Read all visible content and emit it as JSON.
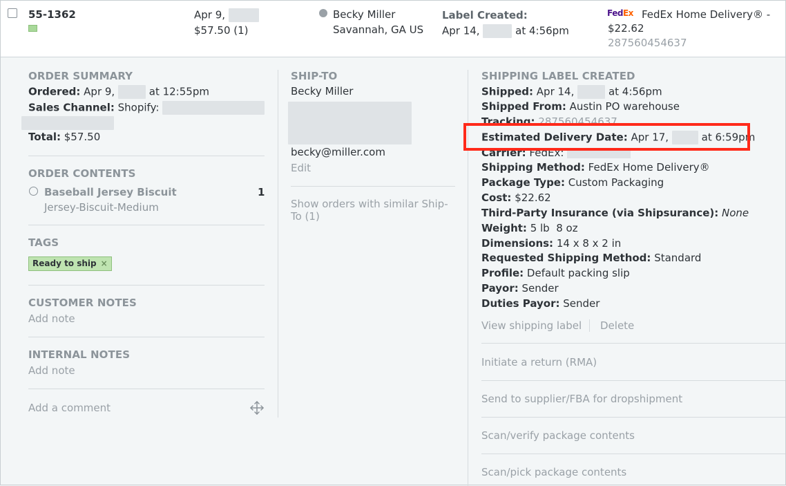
{
  "order": {
    "number": "55-1362",
    "date_prefix": "Apr 9,",
    "amount": "$57.50 (1)",
    "customer_name": "Becky Miller",
    "customer_location": "Savannah, GA US",
    "status_label": "Label Created:",
    "status_date_prefix": "Apr 14,",
    "status_time": "at 4:56pm",
    "carrier_logo_fed": "Fed",
    "carrier_logo_ex": "Ex",
    "carrier_service": "FedEx Home Delivery® -",
    "carrier_cost": "$22.62",
    "tracking_number": "287560454637"
  },
  "summary": {
    "title": "ORDER SUMMARY",
    "ordered_label": "Ordered:",
    "ordered_date": "Apr 9,",
    "ordered_time": "at 12:55pm",
    "sales_channel_label": "Sales Channel:",
    "sales_channel_value": "Shopify:",
    "total_label": "Total:",
    "total_value": "$57.50"
  },
  "contents": {
    "title": "ORDER CONTENTS",
    "item_name": "Baseball Jersey Biscuit",
    "item_sku": "Jersey-Biscuit-Medium",
    "item_qty": "1"
  },
  "tags": {
    "title": "TAGS",
    "tag_label": "Ready to ship",
    "remove_glyph": "×"
  },
  "customer_notes": {
    "title": "CUSTOMER NOTES",
    "add_label": "Add note"
  },
  "internal_notes": {
    "title": "INTERNAL NOTES",
    "add_label": "Add note"
  },
  "comment": {
    "placeholder": "Add a comment"
  },
  "ship_to": {
    "title": "SHIP-TO",
    "name": "Becky Miller",
    "email": "becky@miller.com",
    "edit_label": "Edit",
    "similar_line1": "Show orders with similar Ship-",
    "similar_line2": "To (1)"
  },
  "label": {
    "title": "SHIPPING LABEL CREATED",
    "shipped_label": "Shipped:",
    "shipped_date": "Apr 14,",
    "shipped_time": "at 4:56pm",
    "shipped_from_label": "Shipped From:",
    "shipped_from_value": "Austin PO warehouse",
    "tracking_label": "Tracking:",
    "tracking_value": "287560454637",
    "est_label": "Estimated Delivery Date:",
    "est_date": "Apr 17,",
    "est_time": "at 6:59pm",
    "carrier_label": "Carrier:",
    "carrier_value": "FedEx:",
    "method_label": "Shipping Method:",
    "method_value": "FedEx Home Delivery®",
    "package_label": "Package Type:",
    "package_value": "Custom Packaging",
    "cost_label": "Cost:",
    "cost_value": "$22.62",
    "insurance_label": "Third-Party Insurance (via Shipsurance):",
    "insurance_value": "None",
    "weight_label": "Weight:",
    "weight_value": "5 lb  8 oz",
    "dimensions_label": "Dimensions:",
    "dimensions_value": "14 x 8 x 2 in",
    "requested_label": "Requested Shipping Method:",
    "requested_value": "Standard",
    "profile_label": "Profile:",
    "profile_value": "Default packing slip",
    "payor_label": "Payor:",
    "payor_value": "Sender",
    "duties_label": "Duties Payor:",
    "duties_value": "Sender",
    "view_label": "View shipping label",
    "delete_label": "Delete"
  },
  "actions": {
    "return": "Initiate a return (RMA)",
    "supplier": "Send to supplier/FBA for dropshipment",
    "verify": "Scan/verify package contents",
    "pick": "Scan/pick package contents"
  },
  "colors": {
    "highlight": "#ff2a1a",
    "fedex_purple": "#4d148c",
    "fedex_orange": "#ff6200",
    "tag_green": "#bfe4b1"
  }
}
